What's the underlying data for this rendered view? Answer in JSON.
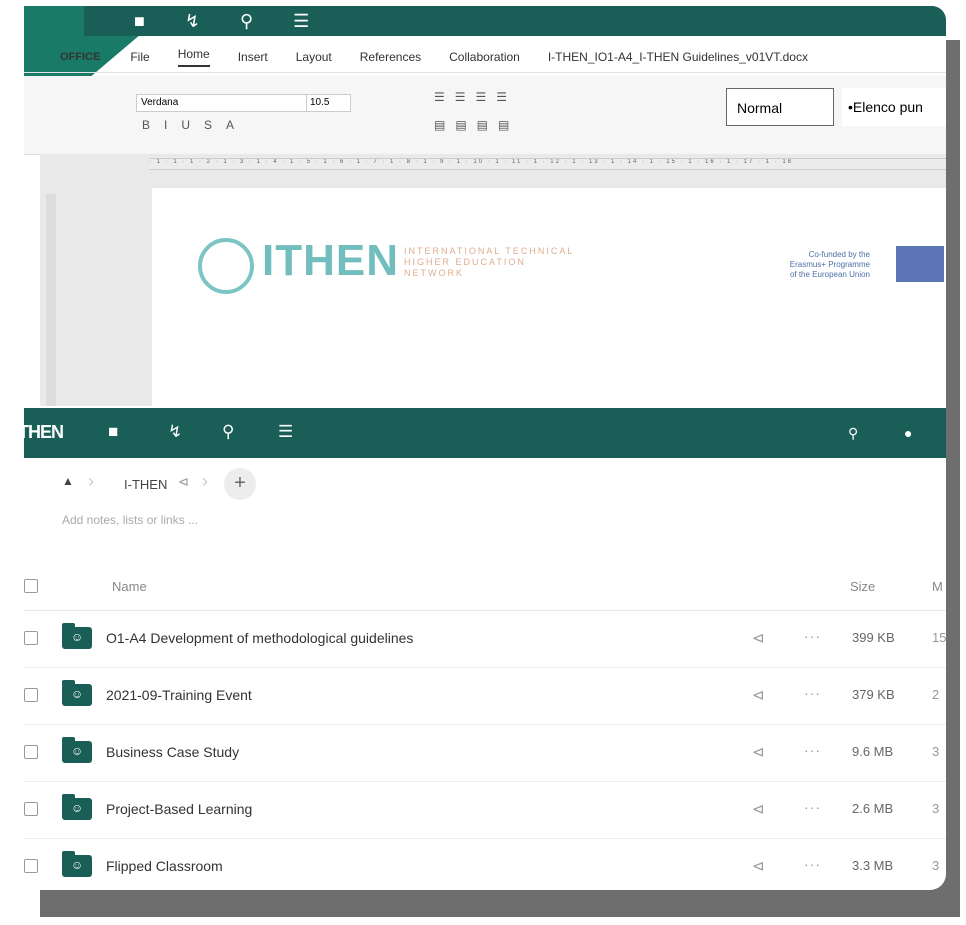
{
  "editor": {
    "brand": "OFFICE",
    "menu": [
      "File",
      "Home",
      "Insert",
      "Layout",
      "References",
      "Collaboration"
    ],
    "doc_title": "I-THEN_IO1-A4_I-THEN Guidelines_v01VT.docx",
    "font_name": "Verdana",
    "font_size": "10.5",
    "style_normal": "Normal",
    "style_list": "•Elenco pun",
    "ruler_text": "· 1 · 1 · 1 · 2 · 1 · 3 · 1 · 4 · 1 · 5 · 1 · 6 · 1 · 7 · 1 · 8 · 1 · 9 · 1 · 10 · 1 · 11 · 1 · 12 · 1 · 13 · 1 · 14 · 1 · 15 · 1 · 16 · 1 · 17 · 1 · 18",
    "logo": "ITHEN",
    "logo_sub_1": "INTERNATIONAL TECHNICAL",
    "logo_sub_2": "HIGHER EDUCATION",
    "logo_sub_3": "NETWORK",
    "cofund_1": "Co-funded by the",
    "cofund_2": "Erasmus+ Programme",
    "cofund_3": "of the European Union"
  },
  "files": {
    "logo": "THEN",
    "breadcrumb": "I-THEN",
    "notes_placeholder": "Add notes, lists or links ...",
    "headers": {
      "name": "Name",
      "size": "Size",
      "modified": "M"
    },
    "rows": [
      {
        "name": "O1-A4 Development of methodological guidelines",
        "size": "399 KB",
        "modified": "15"
      },
      {
        "name": "2021-09-Training Event",
        "size": "379 KB",
        "modified": "2"
      },
      {
        "name": "Business Case Study",
        "size": "9.6 MB",
        "modified": "3"
      },
      {
        "name": "Project-Based Learning",
        "size": "2.6 MB",
        "modified": "3"
      },
      {
        "name": "Flipped Classroom",
        "size": "3.3 MB",
        "modified": "3"
      }
    ]
  },
  "icons": [
    "folder-icon",
    "activity-icon",
    "search-icon",
    "list-icon",
    "notification-icon",
    "share-icon",
    "more-icon",
    "home-icon",
    "plus-icon"
  ]
}
